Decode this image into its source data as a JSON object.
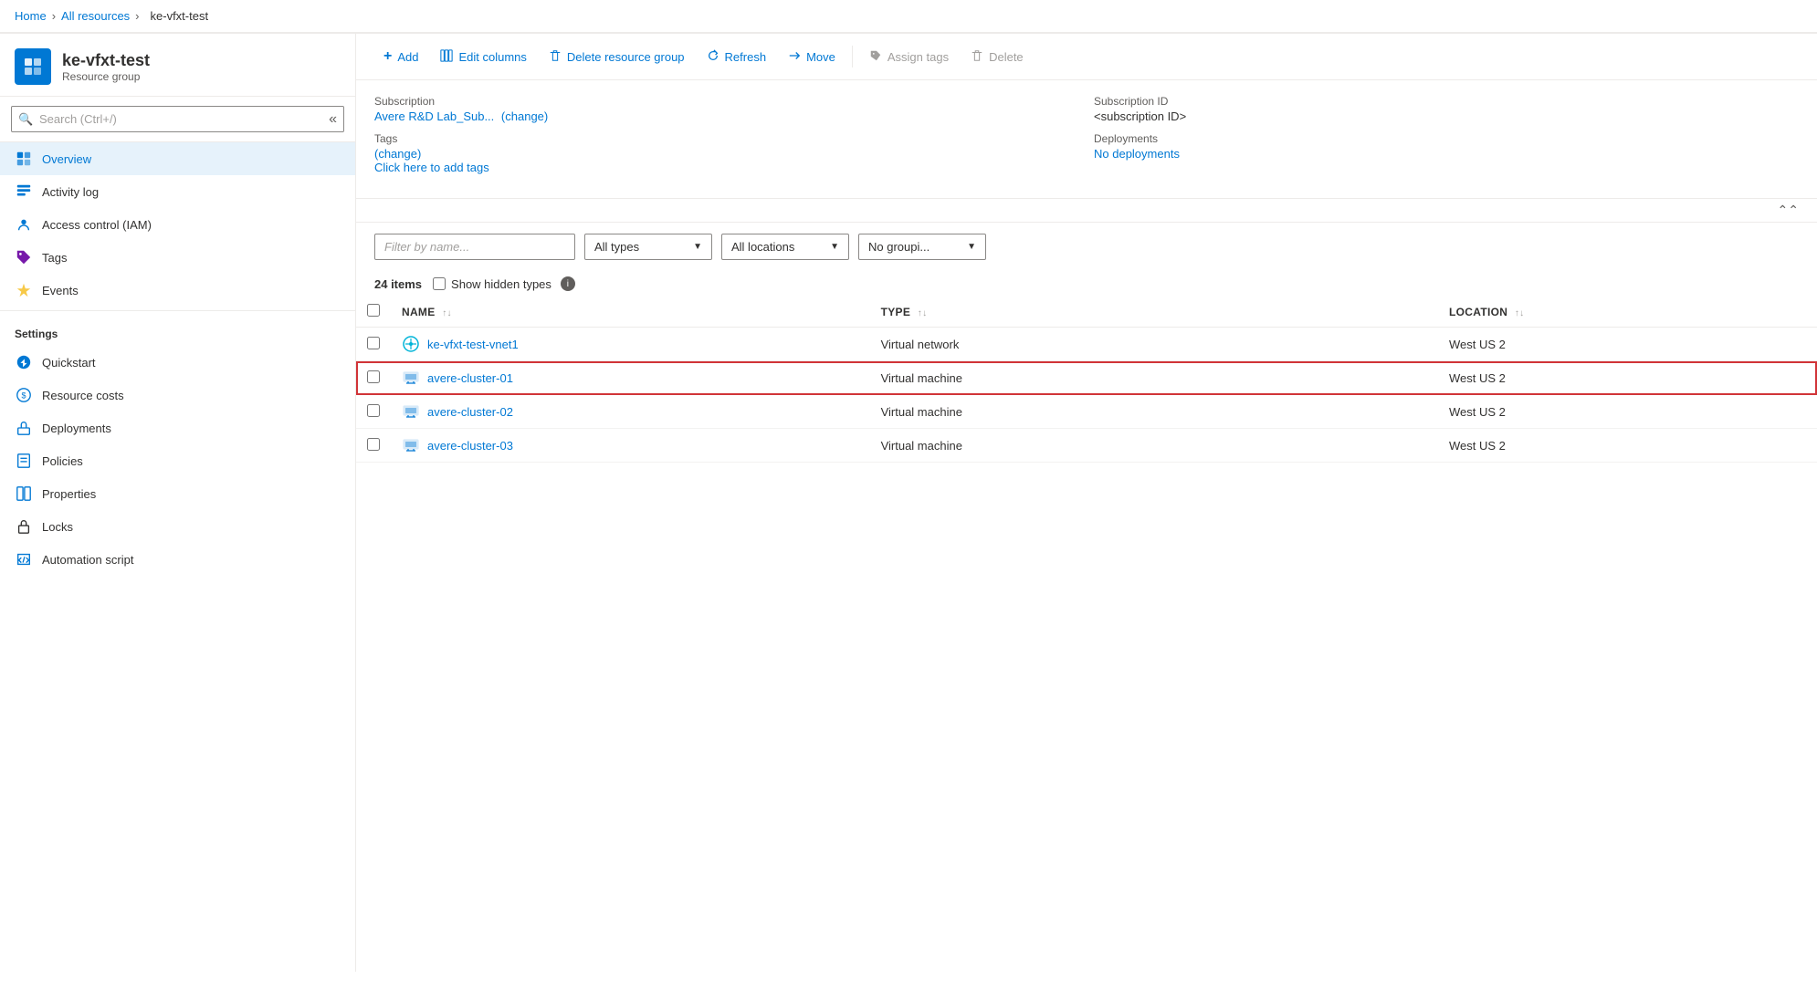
{
  "topBar": {
    "title": ""
  },
  "breadcrumb": {
    "home": "Home",
    "allResources": "All resources",
    "current": "ke-vfxt-test"
  },
  "sidebar": {
    "resourceGroup": {
      "name": "ke-vfxt-test",
      "subtitle": "Resource group"
    },
    "search": {
      "placeholder": "Search (Ctrl+/)"
    },
    "navItems": [
      {
        "id": "overview",
        "label": "Overview",
        "active": true,
        "icon": "cube"
      },
      {
        "id": "activity-log",
        "label": "Activity log",
        "active": false,
        "icon": "list"
      },
      {
        "id": "access-control",
        "label": "Access control (IAM)",
        "active": false,
        "icon": "people"
      },
      {
        "id": "tags",
        "label": "Tags",
        "active": false,
        "icon": "tag"
      },
      {
        "id": "events",
        "label": "Events",
        "active": false,
        "icon": "bolt"
      }
    ],
    "settingsLabel": "Settings",
    "settingsItems": [
      {
        "id": "quickstart",
        "label": "Quickstart",
        "icon": "cloud"
      },
      {
        "id": "resource-costs",
        "label": "Resource costs",
        "icon": "dollar"
      },
      {
        "id": "deployments",
        "label": "Deployments",
        "icon": "deploy"
      },
      {
        "id": "policies",
        "label": "Policies",
        "icon": "policy"
      },
      {
        "id": "properties",
        "label": "Properties",
        "icon": "props"
      },
      {
        "id": "locks",
        "label": "Locks",
        "icon": "lock"
      },
      {
        "id": "automation-script",
        "label": "Automation script",
        "icon": "script"
      }
    ]
  },
  "toolbar": {
    "add": "Add",
    "editColumns": "Edit columns",
    "deleteResourceGroup": "Delete resource group",
    "refresh": "Refresh",
    "move": "Move",
    "assignTags": "Assign tags",
    "delete": "Delete"
  },
  "infoSection": {
    "subscriptionLabel": "Subscription",
    "subscriptionChange": "(change)",
    "subscriptionValue": "Avere R&D Lab_Sub...",
    "tagsLabel": "Tags",
    "tagsChange": "(change)",
    "tagsValue": "Click here to add tags",
    "subscriptionIdLabel": "Subscription ID",
    "subscriptionIdValue": "<subscription ID>",
    "deploymentsLabel": "Deployments",
    "deploymentsValue": "No deployments"
  },
  "filters": {
    "filterPlaceholder": "Filter by name...",
    "typeDropdown": "All types",
    "locationDropdown": "All locations",
    "groupingDropdown": "No groupi..."
  },
  "itemsRow": {
    "count": "24 items",
    "showHiddenTypes": "Show hidden types"
  },
  "tableHeaders": {
    "name": "NAME",
    "type": "TYPE",
    "location": "LOCATION"
  },
  "resources": [
    {
      "id": "row1",
      "name": "ke-vfxt-test-vnet1",
      "type": "Virtual network",
      "location": "West US 2",
      "highlighted": false,
      "iconType": "vnet"
    },
    {
      "id": "row2",
      "name": "avere-cluster-01",
      "type": "Virtual machine",
      "location": "West US 2",
      "highlighted": true,
      "iconType": "vm"
    },
    {
      "id": "row3",
      "name": "avere-cluster-02",
      "type": "Virtual machine",
      "location": "West US 2",
      "highlighted": false,
      "iconType": "vm"
    },
    {
      "id": "row4",
      "name": "avere-cluster-03",
      "type": "Virtual machine",
      "location": "West US 2",
      "highlighted": false,
      "iconType": "vm"
    }
  ],
  "colors": {
    "accent": "#0078d4",
    "highlight": "#d13438",
    "activeBg": "#e6f2fb"
  }
}
